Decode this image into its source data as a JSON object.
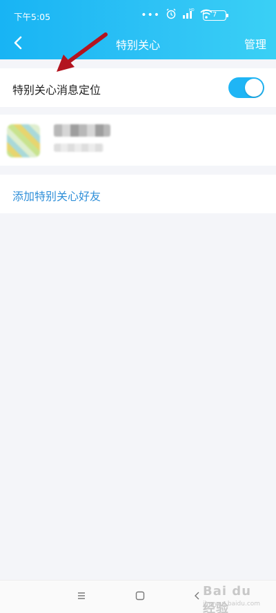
{
  "status_bar": {
    "time": "下午5:05",
    "battery": "7"
  },
  "nav": {
    "title": "特别关心",
    "manage_label": "管理"
  },
  "settings": {
    "locate_label": "特别关心消息定位",
    "locate_enabled": true
  },
  "actions": {
    "add_label": "添加特别关心好友"
  },
  "colors": {
    "header_gradient_start": "#18b4f4",
    "header_gradient_end": "#3ad0f5",
    "toggle_on": "#1fb5f5",
    "link": "#2f8fd9",
    "annotation_arrow": "#b3141f"
  },
  "watermark": {
    "main": "Bai du 经验",
    "sub": "jingyan.baidu.com"
  },
  "icons": {
    "back": "chevron-left-icon",
    "alarm": "alarm-clock-icon",
    "wifi": "wifi-icon",
    "signal": "signal-icon",
    "battery": "battery-icon",
    "menu": "menu-lines-icon",
    "home": "square-home-icon",
    "nav_back": "triangle-back-icon"
  }
}
